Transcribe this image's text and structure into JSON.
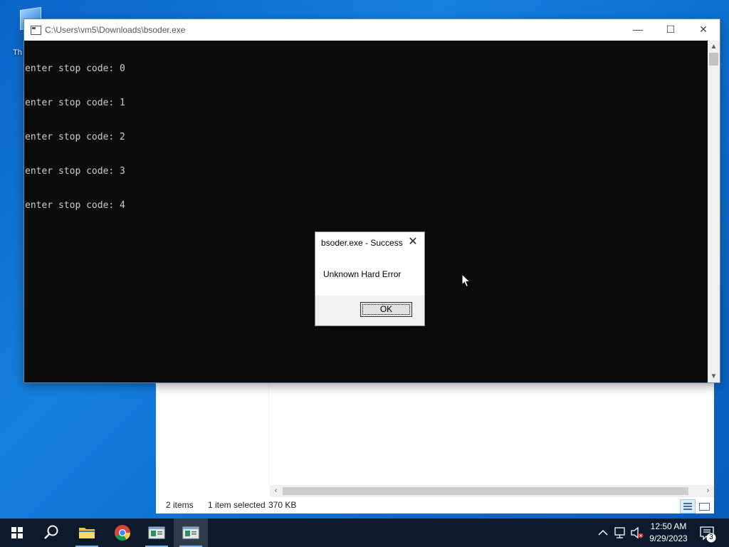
{
  "desktop": {
    "icon_label": "Th"
  },
  "explorer": {
    "status_items": "2 items",
    "status_selected": "1 item selected",
    "status_size": "370 KB"
  },
  "console": {
    "title": "C:\\Users\\vm5\\Downloads\\bsoder.exe",
    "lines": [
      "enter stop code: 0",
      "enter stop code: 1",
      "enter stop code: 2",
      "enter stop code: 3",
      "enter stop code: 4"
    ],
    "minimize_glyph": "—",
    "maximize_glyph": "☐",
    "close_glyph": "✕"
  },
  "dialog": {
    "title": "bsoder.exe - Success",
    "message": "Unknown Hard Error",
    "ok_label": "OK",
    "close_glyph": "✕"
  },
  "taskbar": {
    "apps": [
      "start-icon",
      "search-icon",
      "file-explorer-icon",
      "chrome-icon",
      "console-icon",
      "console-icon-2"
    ],
    "clock_time": "12:50 AM",
    "clock_date": "9/29/2023",
    "notification_count": "3",
    "accent_color": "#76b9ed"
  }
}
